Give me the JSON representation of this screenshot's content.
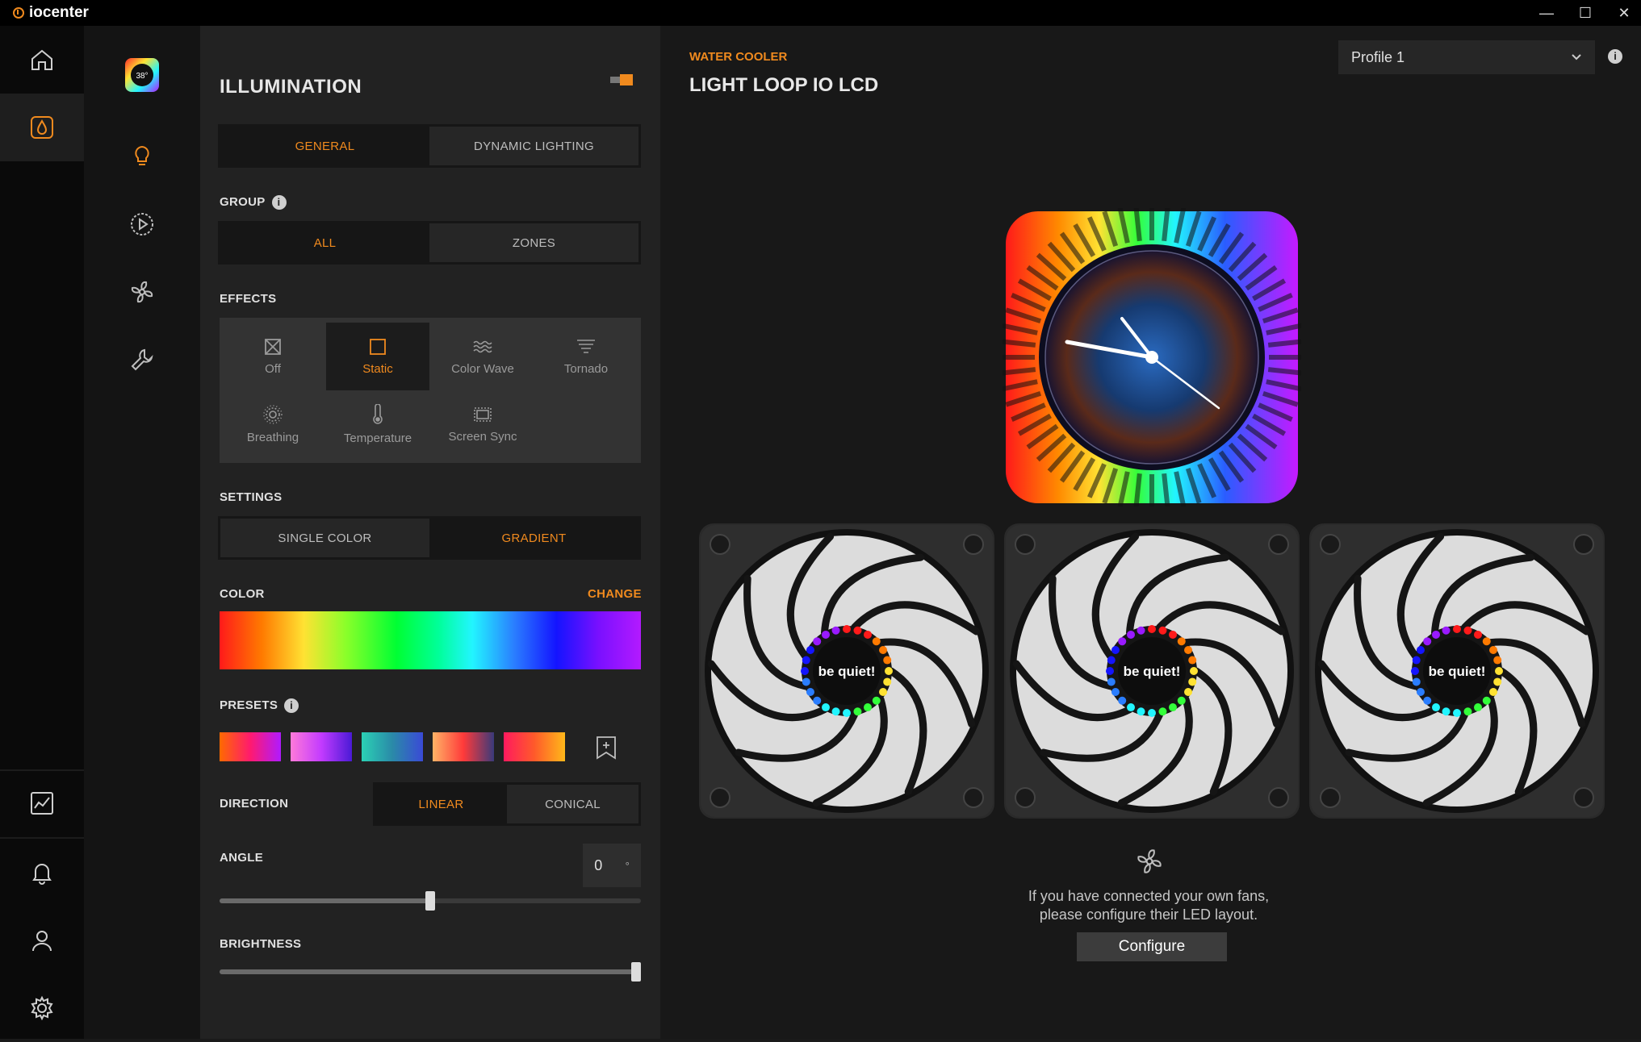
{
  "app": {
    "title": "iocenter"
  },
  "window_controls": {
    "minimize": "—",
    "maximize": "☐",
    "close": "✕"
  },
  "rail": {
    "items": [
      {
        "name": "home-icon",
        "active": false
      },
      {
        "name": "drop-icon",
        "active": true
      },
      {
        "name": "chart-icon",
        "active": false
      },
      {
        "name": "bell-icon",
        "active": false
      },
      {
        "name": "user-icon",
        "active": false
      },
      {
        "name": "gear-icon",
        "active": false
      }
    ]
  },
  "subrail": {
    "device_badge": "38°",
    "items": [
      "device-thumbnail",
      "bulb-icon",
      "play-icon",
      "fan-icon",
      "wrench-icon"
    ]
  },
  "panel": {
    "title": "ILLUMINATION",
    "tabs": {
      "general": "GENERAL",
      "dynamic": "DYNAMIC LIGHTING"
    },
    "group": {
      "label": "GROUP",
      "all": "ALL",
      "zones": "ZONES"
    },
    "effects": {
      "label": "EFFECTS",
      "items": [
        {
          "label": "Off",
          "icon": "off-icon"
        },
        {
          "label": "Static",
          "icon": "square-icon",
          "selected": true
        },
        {
          "label": "Color Wave",
          "icon": "wave-icon"
        },
        {
          "label": "Tornado",
          "icon": "tornado-icon"
        },
        {
          "label": "Breathing",
          "icon": "breathing-icon"
        },
        {
          "label": "Temperature",
          "icon": "thermometer-icon"
        },
        {
          "label": "Screen Sync",
          "icon": "screen-sync-icon"
        }
      ]
    },
    "settings": {
      "label": "SETTINGS",
      "single": "SINGLE COLOR",
      "gradient": "GRADIENT"
    },
    "color": {
      "label": "COLOR",
      "change": "CHANGE"
    },
    "presets": {
      "label": "PRESETS"
    },
    "direction": {
      "label": "DIRECTION",
      "linear": "LINEAR",
      "conical": "CONICAL"
    },
    "angle": {
      "label": "ANGLE",
      "value": "0",
      "unit": "°",
      "slider_fraction": 0.5
    },
    "brightness": {
      "label": "BRIGHTNESS",
      "slider_fraction": 1.0
    }
  },
  "main": {
    "category": "WATER COOLER",
    "device": "LIGHT LOOP IO LCD",
    "profile": "Profile 1",
    "fan_brand": "be quiet!",
    "fan_message_1": "If you have connected your own fans,",
    "fan_message_2": "please configure their LED layout.",
    "configure": "Configure"
  },
  "colors": {
    "accent": "#f08a1e",
    "panel": "#222222",
    "main": "#181818"
  }
}
